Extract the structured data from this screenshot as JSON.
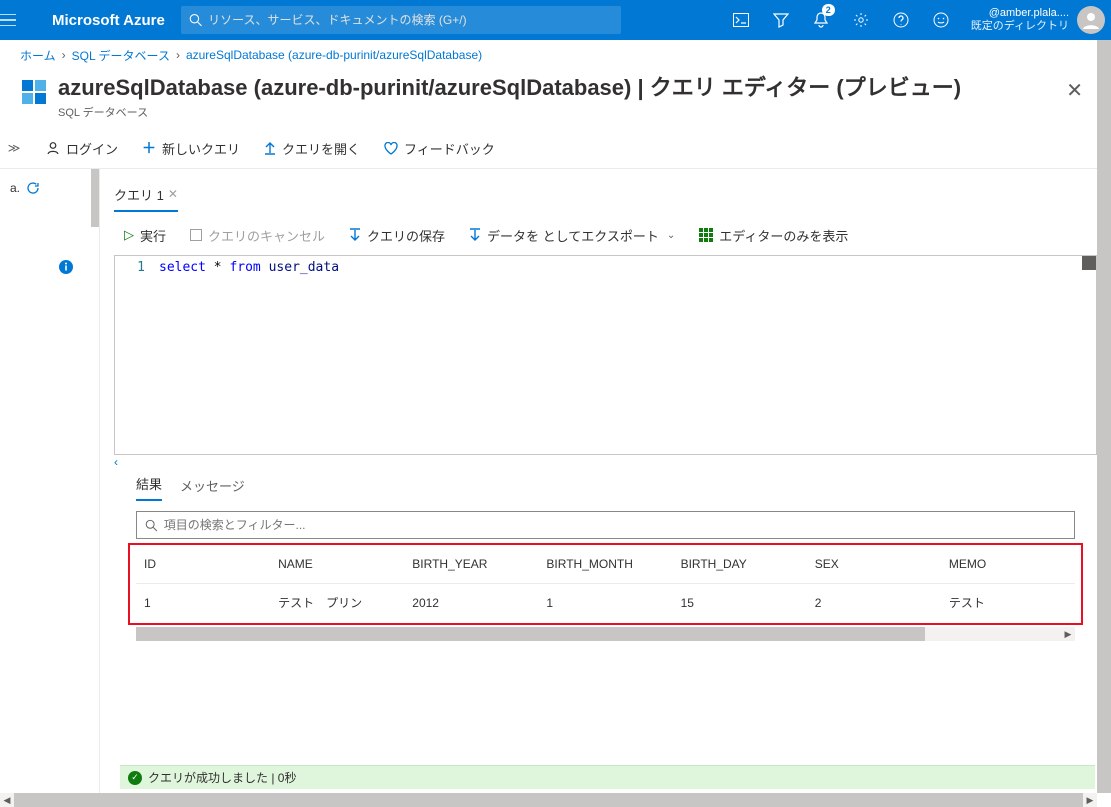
{
  "topbar": {
    "brand": "Microsoft Azure",
    "search_placeholder": "リソース、サービス、ドキュメントの検索 (G+/)",
    "notification_count": "2",
    "account_email": "@amber.plala....",
    "account_dir": "既定のディレクトリ"
  },
  "breadcrumb": {
    "home": "ホーム",
    "db_list": "SQL データベース",
    "current": "azureSqlDatabase (azure-db-purinit/azureSqlDatabase)"
  },
  "heading": {
    "title": "azureSqlDatabase (azure-db-purinit/azureSqlDatabase) | クエリ エディター (プレビュー)",
    "subtitle": "SQL データベース"
  },
  "commandbar": {
    "login": "ログイン",
    "new_query": "新しいクエリ",
    "open_query": "クエリを開く",
    "feedback": "フィードバック"
  },
  "left_rail": {
    "item_a": "a."
  },
  "query_tabs": {
    "tab1": "クエリ 1"
  },
  "query_toolbar": {
    "run": "実行",
    "cancel": "クエリのキャンセル",
    "save": "クエリの保存",
    "export": "データを としてエクスポート",
    "editor_only": "エディターのみを表示"
  },
  "editor": {
    "line_no": "1",
    "kw_select": "select",
    "star": " * ",
    "kw_from": "from",
    "table": " user_data"
  },
  "results": {
    "tab_results": "結果",
    "tab_messages": "メッセージ",
    "search_placeholder": "項目の検索とフィルター...",
    "columns": [
      "ID",
      "NAME",
      "BIRTH_YEAR",
      "BIRTH_MONTH",
      "BIRTH_DAY",
      "SEX",
      "MEMO"
    ],
    "row": [
      "1",
      "テスト　プリン",
      "2012",
      "1",
      "15",
      "2",
      "テスト"
    ]
  },
  "status": {
    "message": "クエリが成功しました | 0秒"
  }
}
